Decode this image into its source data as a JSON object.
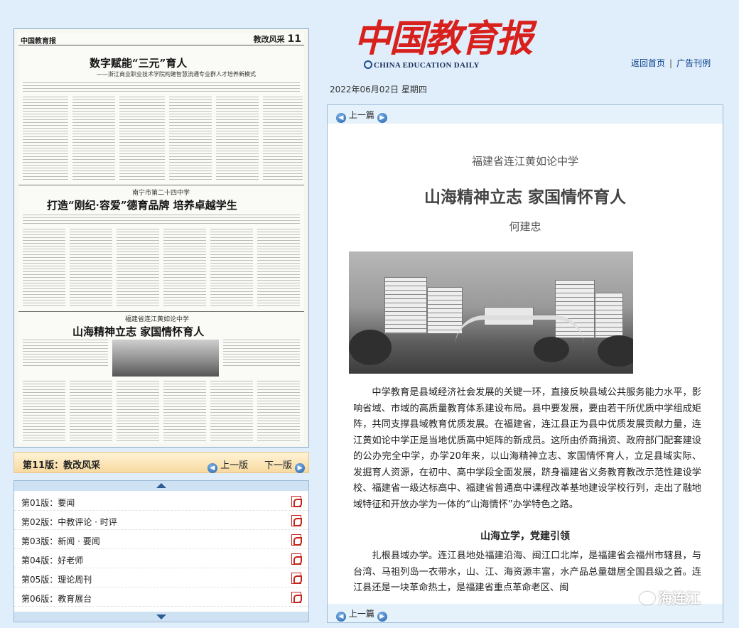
{
  "header": {
    "logo_cn": "中国教育报",
    "logo_en": "CHINA EDUCATION DAILY",
    "links": [
      "返回首页",
      "广告刊例"
    ],
    "date": "2022年06月02日 星期四"
  },
  "thumbnail": {
    "paper_name": "中国教育报",
    "page_label": "教改风采",
    "page_num": "11",
    "title1": "数字赋能“三元”育人",
    "sub1": "——浙江商业职业技术学院构建智慧流通专业群人才培养新模式",
    "school2": "南宁市第二十四中学",
    "title2": "打造“刚纪·容爱”德育品牌 培养卓越学生",
    "school3": "福建省连江黄如论中学",
    "title3": "山海精神立志 家国情怀育人"
  },
  "pagebar": {
    "label": "第11版：教改风采",
    "prev": "上一版",
    "next": "下一版"
  },
  "sections": [
    {
      "label": "第01版：要闻"
    },
    {
      "label": "第02版：中教评论 · 时评"
    },
    {
      "label": "第03版：新闻 · 要闻"
    },
    {
      "label": "第04版：好老师"
    },
    {
      "label": "第05版：理论周刊"
    },
    {
      "label": "第06版：教育展台"
    }
  ],
  "article": {
    "nav_top": "上一篇",
    "nav_bottom": "上一篇",
    "kicker": "福建省连江黄如论中学",
    "headline": "山海精神立志 家国情怀育人",
    "author": "何建忠",
    "para1": "中学教育是县域经济社会发展的关键一环，直接反映县域公共服务能力水平，影响省域、市域的高质量教育体系建设布局。县中要发展，要由若干所优质中学组成矩阵，共同支撑县域教育优质发展。在福建省，连江县正为县中优质发展贡献力量，连江黄如论中学正是当地优质高中矩阵的新成员。这所由侨商捐资、政府部门配套建设的公办完全中学，办学20年来，以山海精神立志、家国情怀育人，立足县域实际、发掘育人资源，在初中、高中学段全面发展，跻身福建省义务教育教改示范性建设学校、福建省一级达标高中、福建省普通高中课程改革基地建设学校行列，走出了融地域特征和开放办学为一体的“山海情怀”办学特色之路。",
    "subhead": "山海立学，党建引领",
    "para2": "扎根县域办学。连江县地处福建沿海、闽江口北岸，是福建省会福州市辖县，与台湾、马祖列岛一衣带水，山、江、海资源丰富，水产品总量雄居全国县级之首。连江县还是一块革命热土，是福建省重点革命老区、闽"
  },
  "watermark": "海连江"
}
